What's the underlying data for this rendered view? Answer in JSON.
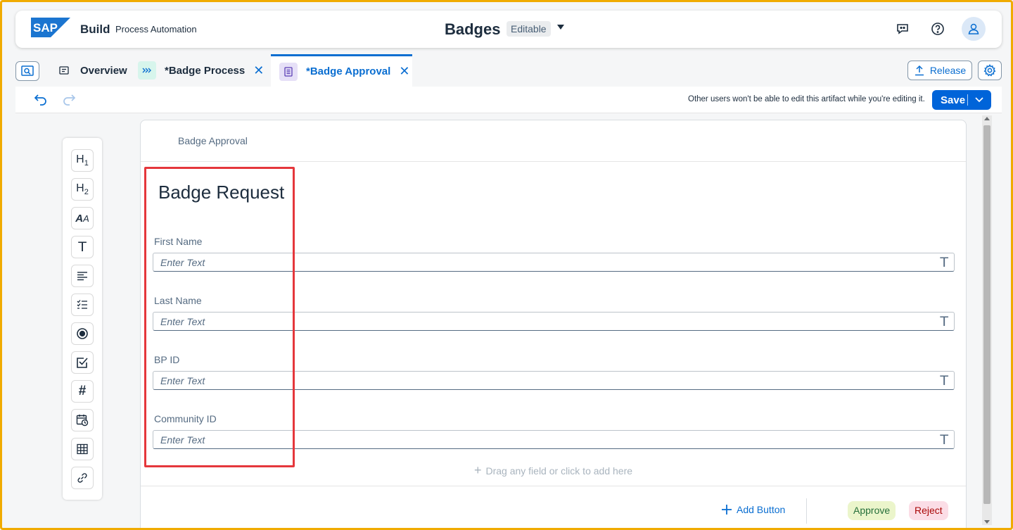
{
  "shell": {
    "logo_text": "SAP",
    "product": "Build",
    "subproduct": "Process Automation",
    "title": "Badges",
    "status_badge": "Editable",
    "icons": [
      "feedback-icon",
      "help-icon",
      "user-avatar-icon"
    ]
  },
  "tabs": [
    {
      "label": "Overview",
      "icon": "overview-icon",
      "active": false,
      "closable": false
    },
    {
      "label": "*Badge Process",
      "icon": "process-icon",
      "active": false,
      "closable": true
    },
    {
      "label": "*Badge Approval",
      "icon": "form-icon",
      "active": true,
      "closable": true
    }
  ],
  "tab_actions": {
    "release_label": "Release"
  },
  "toolbar": {
    "lock_message": "Other users won't be able to edit this artifact while you're editing it.",
    "save_label": "Save"
  },
  "palette": [
    {
      "name": "heading1",
      "glyph": "H₁"
    },
    {
      "name": "heading2",
      "glyph": "H₂"
    },
    {
      "name": "paragraph-style",
      "glyph": "A"
    },
    {
      "name": "text",
      "glyph": "T"
    },
    {
      "name": "paragraph",
      "glyph": "≡"
    },
    {
      "name": "checklist",
      "glyph": "☰"
    },
    {
      "name": "radio",
      "glyph": "◉"
    },
    {
      "name": "checkbox",
      "glyph": "☑"
    },
    {
      "name": "number",
      "glyph": "#"
    },
    {
      "name": "date",
      "glyph": "📅"
    },
    {
      "name": "table",
      "glyph": "▦"
    },
    {
      "name": "link",
      "glyph": "🔗"
    }
  ],
  "form": {
    "header_label": "Badge Approval",
    "heading": "Badge Request",
    "fields": [
      {
        "label": "First Name",
        "placeholder": "Enter Text"
      },
      {
        "label": "Last Name",
        "placeholder": "Enter Text"
      },
      {
        "label": "BP ID",
        "placeholder": "Enter Text"
      },
      {
        "label": "Community ID",
        "placeholder": "Enter Text"
      }
    ],
    "field_type_glyph": "T",
    "drag_hint": "Drag any field or click to add here",
    "add_button_label": "Add Button",
    "approve_label": "Approve",
    "reject_label": "Reject"
  },
  "colors": {
    "accent": "#0a6ed1",
    "highlight": "#e5373c",
    "frame": "#f0ab00"
  }
}
